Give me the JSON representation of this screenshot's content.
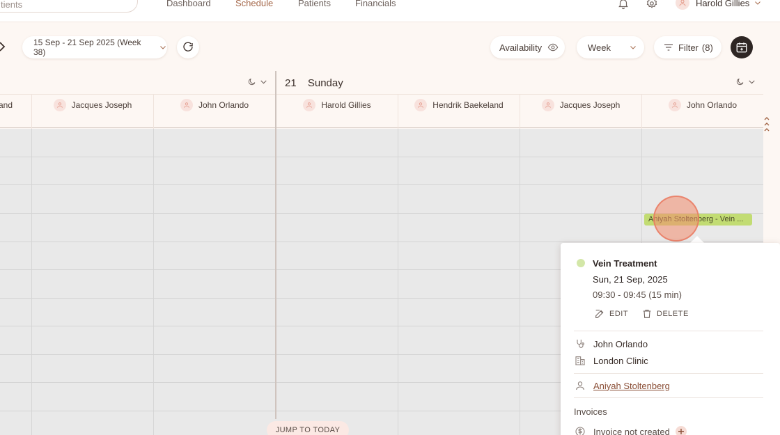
{
  "search": {
    "placeholder": "tients"
  },
  "nav": {
    "items": [
      {
        "label": "Dashboard",
        "active": false
      },
      {
        "label": "Schedule",
        "active": true
      },
      {
        "label": "Patients",
        "active": false
      },
      {
        "label": "Financials",
        "active": false
      }
    ]
  },
  "user": {
    "name": "Harold Gillies"
  },
  "toolbar": {
    "date_range": "15 Sep - 21 Sep 2025 (Week 38)",
    "availability_label": "Availability",
    "view_label": "Week",
    "filter_label": "Filter",
    "filter_count": "(8)"
  },
  "days": [
    {
      "staff": [
        "and",
        "Jacques Joseph",
        "John Orlando"
      ]
    },
    {
      "day_number": "21",
      "day_name": "Sunday",
      "staff": [
        "Harold Gillies",
        "Hendrik Baekeland",
        "Jacques Joseph",
        "John Orlando"
      ]
    }
  ],
  "appointment": {
    "label": "Aniyah Stoltenberg - Vein ..."
  },
  "popover": {
    "title": "Vein Treatment",
    "date": "Sun, 21 Sep, 2025",
    "time": "09:30 - 09:45 (15 min)",
    "edit_label": "EDIT",
    "delete_label": "DELETE",
    "practitioner": "John Orlando",
    "location": "London Clinic",
    "patient": "Aniyah Stoltenberg",
    "invoices_heading": "Invoices",
    "invoice_status": "Invoice not created"
  },
  "jump_today": "JUMP TO TODAY",
  "colors": {
    "accent": "#a4684a",
    "appointment": "#c2dc73",
    "status_dot": "#d3e7a8",
    "dark_button": "#2e2624"
  }
}
